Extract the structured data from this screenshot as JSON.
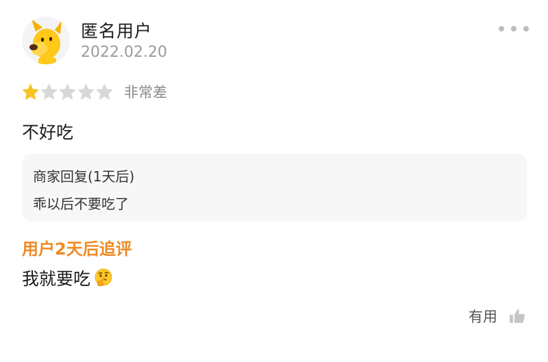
{
  "review": {
    "username": "匿名用户",
    "date": "2022.02.20",
    "rating": 1,
    "rating_max": 5,
    "rating_label": "非常差",
    "text": "不好吃",
    "avatar_icon": "yellow-dog-mascot-icon",
    "more_icon": "more-dots-icon"
  },
  "merchant_reply": {
    "title": "商家回复(1天后)",
    "text": "乖以后不要吃了"
  },
  "followup": {
    "label": "用户2天后追评",
    "text": "我就要吃",
    "emoji": "thinking-face-emoji"
  },
  "actions": {
    "useful_label": "有用",
    "useful_icon": "thumbs-up-icon"
  },
  "colors": {
    "star_active": "#f6c324",
    "star_inactive": "#d8d8d8",
    "followup_accent": "#f08a24",
    "reply_background": "#f7f7f7"
  }
}
